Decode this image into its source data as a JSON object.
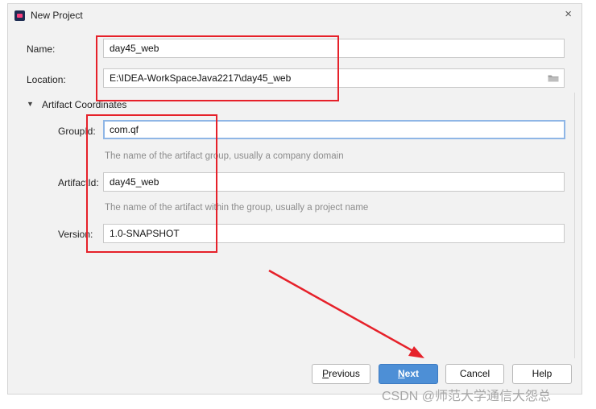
{
  "window": {
    "title": "New Project",
    "close_symbol": "×"
  },
  "name": {
    "label": "Name:",
    "value": "day45_web"
  },
  "location": {
    "label": "Location:",
    "value": "E:\\IDEA-WorkSpaceJava2217\\day45_web",
    "icon": "folder-icon"
  },
  "artifact_coordinates": {
    "title": "Artifact Coordinates",
    "expanded": true,
    "group_id": {
      "label": "GroupId:",
      "value": "com.qf",
      "hint": "The name of the artifact group, usually a company domain"
    },
    "artifact_id": {
      "label": "ArtifactId:",
      "value": "day45_web",
      "hint": "The name of the artifact within the group, usually a project name"
    },
    "version": {
      "label": "Version:",
      "value": "1.0-SNAPSHOT"
    }
  },
  "buttons": {
    "previous": {
      "mnemonic": "P",
      "rest": "revious"
    },
    "next": {
      "mnemonic": "N",
      "rest": "ext"
    },
    "cancel": "Cancel",
    "help": "Help"
  },
  "annotations": {
    "highlight_color": "#e6212a"
  },
  "watermark": "CSDN @师范大学通信大怨总"
}
